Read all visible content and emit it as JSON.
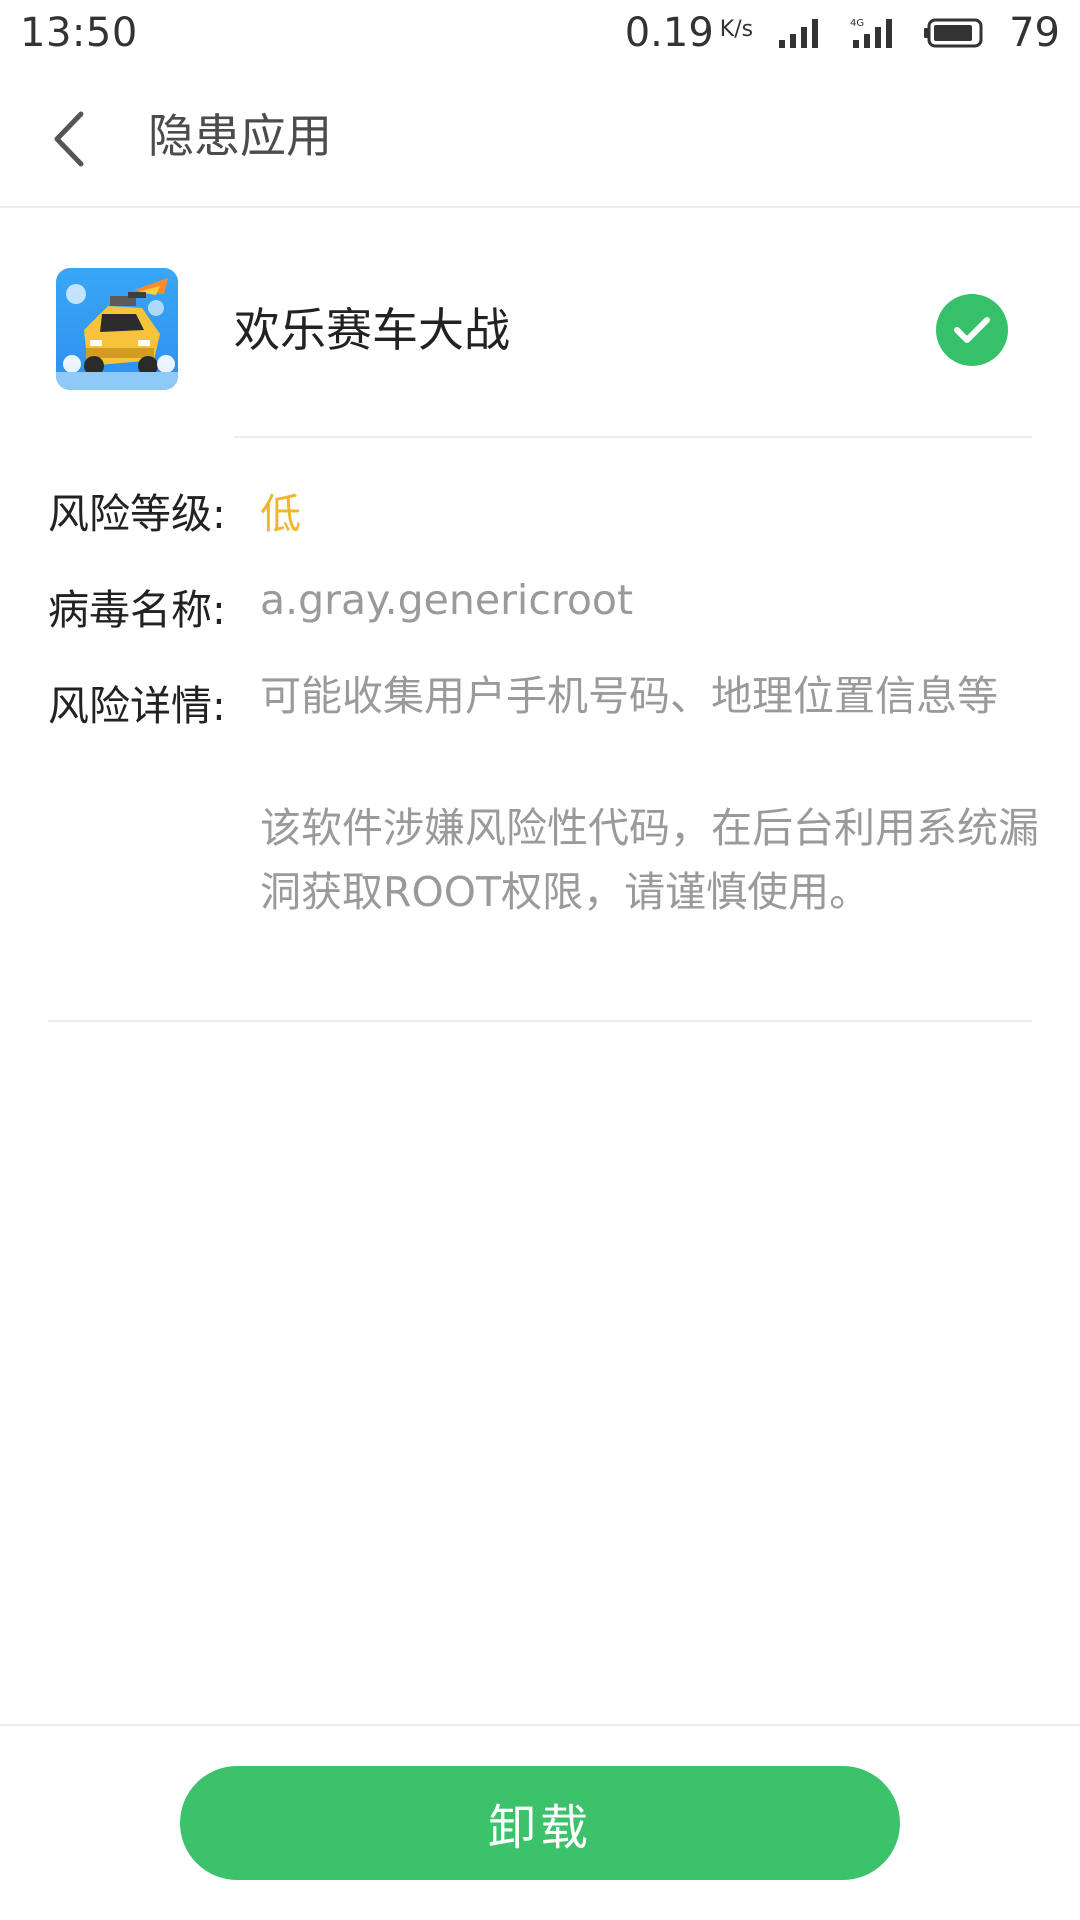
{
  "status_bar": {
    "time": "13:50",
    "net_speed": "0.19",
    "net_unit": "K/s",
    "network_label": "4G",
    "battery": "79",
    "icons": [
      "signal-icon",
      "signal-4g-icon",
      "battery-icon"
    ]
  },
  "header": {
    "title": "隐患应用",
    "back_icon": "chevron-left-icon"
  },
  "app": {
    "name": "欢乐赛车大战",
    "icon": "racing-car-game-icon",
    "status_icon": "check-circle-icon",
    "status_color": "#37c06a"
  },
  "details": {
    "risk_level_label": "风险等级:",
    "risk_level_value": "低",
    "risk_level_color": "#f3b52a",
    "virus_name_label": "病毒名称:",
    "virus_name_value": "a.gray.genericroot",
    "risk_detail_label": "风险详情:",
    "risk_detail_line1": "可能收集用户手机号码、地理位置信息等",
    "risk_detail_paragraph2": "该软件涉嫌风险性代码，在后台利用系统漏洞获取ROOT权限，请谨慎使用。"
  },
  "actions": {
    "uninstall_label": "卸载",
    "button_color": "#3cc26b"
  }
}
